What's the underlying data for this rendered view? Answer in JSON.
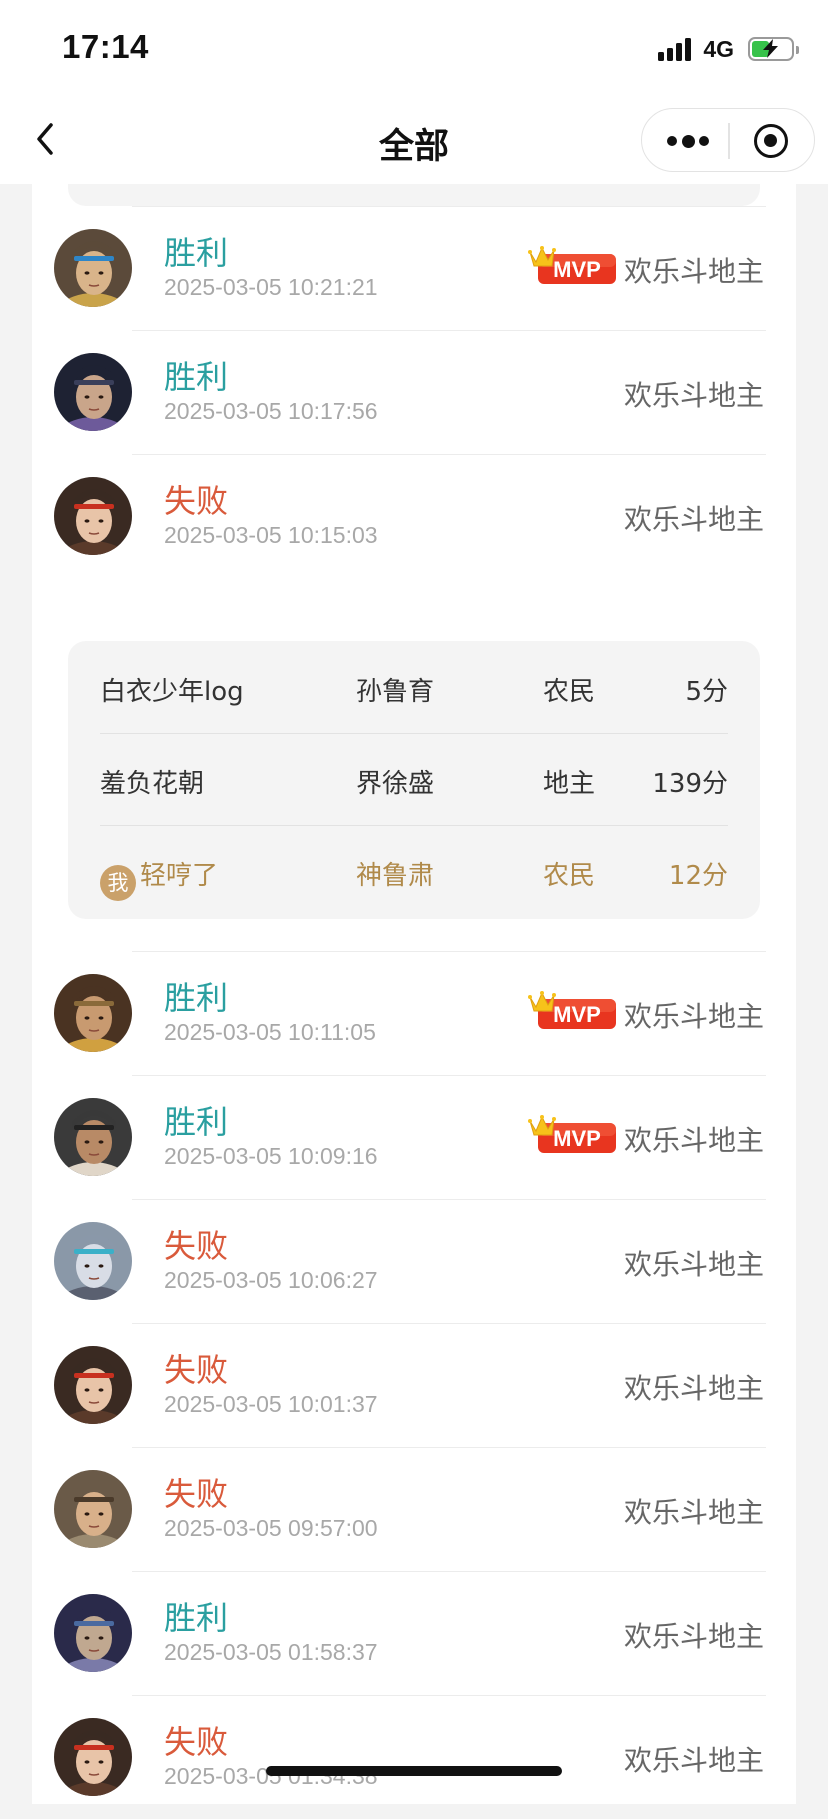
{
  "status_bar": {
    "time": "17:14",
    "network": "4G",
    "battery_level": 0.4,
    "battery_charging": true,
    "signal_bars": 4
  },
  "nav": {
    "title": "全部",
    "back_icon": "chevron-left-icon",
    "more_icon": "more-dots-icon",
    "close_icon": "target-close-icon"
  },
  "colors": {
    "win": "#2a9fa0",
    "lose": "#d95a3b",
    "me": "#b08a4a",
    "mvp": "#e8351f"
  },
  "mvp_label": "MVP",
  "games": [
    {
      "result": "胜利",
      "outcome": "win",
      "time": "2025-03-05 10:21:21",
      "mvp": true,
      "mode": "欢乐斗地主",
      "avatar": "hero-avatar-1"
    },
    {
      "result": "胜利",
      "outcome": "win",
      "time": "2025-03-05 10:17:56",
      "mvp": false,
      "mode": "欢乐斗地主",
      "avatar": "hero-avatar-2"
    },
    {
      "result": "失败",
      "outcome": "lose",
      "time": "2025-03-05 10:15:03",
      "mvp": false,
      "mode": "欢乐斗地主",
      "avatar": "hero-avatar-3"
    },
    {
      "result": "胜利",
      "outcome": "win",
      "time": "2025-03-05 10:11:05",
      "mvp": true,
      "mode": "欢乐斗地主",
      "avatar": "hero-avatar-4"
    },
    {
      "result": "胜利",
      "outcome": "win",
      "time": "2025-03-05 10:09:16",
      "mvp": true,
      "mode": "欢乐斗地主",
      "avatar": "hero-avatar-5"
    },
    {
      "result": "失败",
      "outcome": "lose",
      "time": "2025-03-05 10:06:27",
      "mvp": false,
      "mode": "欢乐斗地主",
      "avatar": "hero-avatar-6"
    },
    {
      "result": "失败",
      "outcome": "lose",
      "time": "2025-03-05 10:01:37",
      "mvp": false,
      "mode": "欢乐斗地主",
      "avatar": "hero-avatar-3"
    },
    {
      "result": "失败",
      "outcome": "lose",
      "time": "2025-03-05 09:57:00",
      "mvp": false,
      "mode": "欢乐斗地主",
      "avatar": "hero-avatar-7"
    },
    {
      "result": "胜利",
      "outcome": "win",
      "time": "2025-03-05 01:58:37",
      "mvp": false,
      "mode": "欢乐斗地主",
      "avatar": "hero-avatar-8"
    },
    {
      "result": "失败",
      "outcome": "lose",
      "time": "2025-03-05 01:34:38",
      "mvp": false,
      "mode": "欢乐斗地主",
      "avatar": "hero-avatar-3"
    }
  ],
  "detail": {
    "me_badge": "我",
    "players": [
      {
        "name": "白衣少年log",
        "hero": "孙鲁育",
        "role": "农民",
        "score": "5分",
        "is_me": false
      },
      {
        "name": "羞负花朝",
        "hero": "界徐盛",
        "role": "地主",
        "score": "139分",
        "is_me": false
      },
      {
        "name": "轻哼了",
        "hero": "神鲁肃",
        "role": "农民",
        "score": "12分",
        "is_me": true
      }
    ]
  }
}
